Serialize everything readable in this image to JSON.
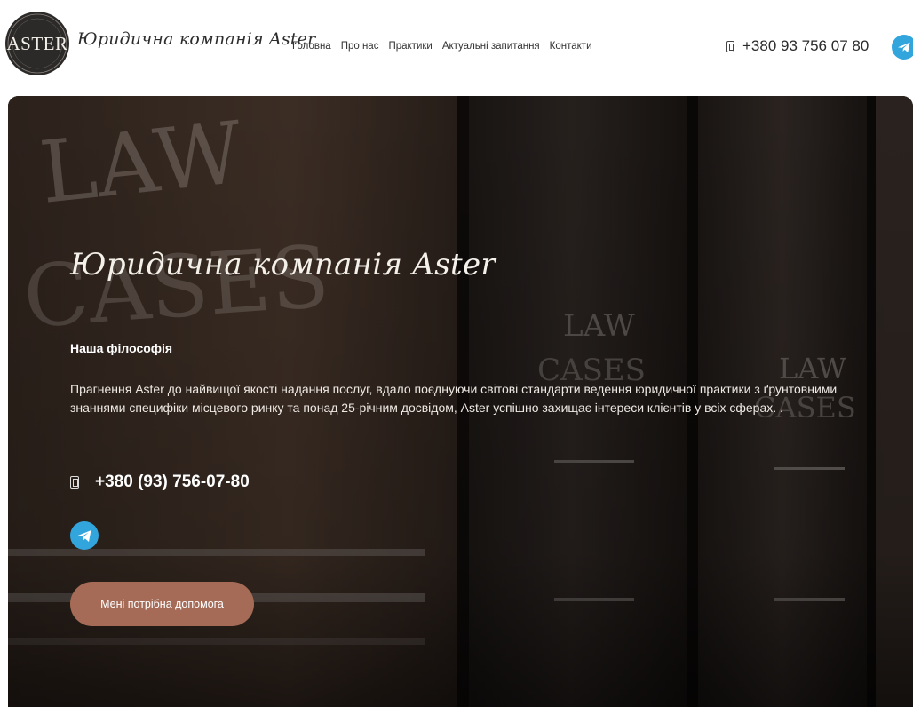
{
  "header": {
    "logo_text": "ASTER",
    "brand_name": "Юридична компанія Aster",
    "nav": [
      {
        "label": "Головна"
      },
      {
        "label": "Про нас"
      },
      {
        "label": "Практики"
      },
      {
        "label": "Актуальні запитання"
      },
      {
        "label": "Контакти"
      }
    ],
    "phone": "+380 93 756 07 80",
    "phone_icon": "phone-icon",
    "telegram_icon": "telegram-icon"
  },
  "hero": {
    "title": "Юридична компанія Aster",
    "philosophy_heading": "Наша філософія",
    "philosophy_text": "Прагнення Aster до найвищої якості надання послуг, вдало поєднуючи світові стандарти ведення юридичної практики з ґрунтовними знаннями специфіки місцевого ринку та понад 25-річним досвідом, Aster успішно захищає інтереси клієнтів у всіх сферах. .",
    "phone": "+380 (93) 756-07-80",
    "help_button_label": "Мені потрібна допомога",
    "background_image": "law-books-photo"
  },
  "colors": {
    "accent_button": "#a66b57",
    "telegram_blue": "#32a5dd",
    "logo_dark": "#2c2a29"
  }
}
